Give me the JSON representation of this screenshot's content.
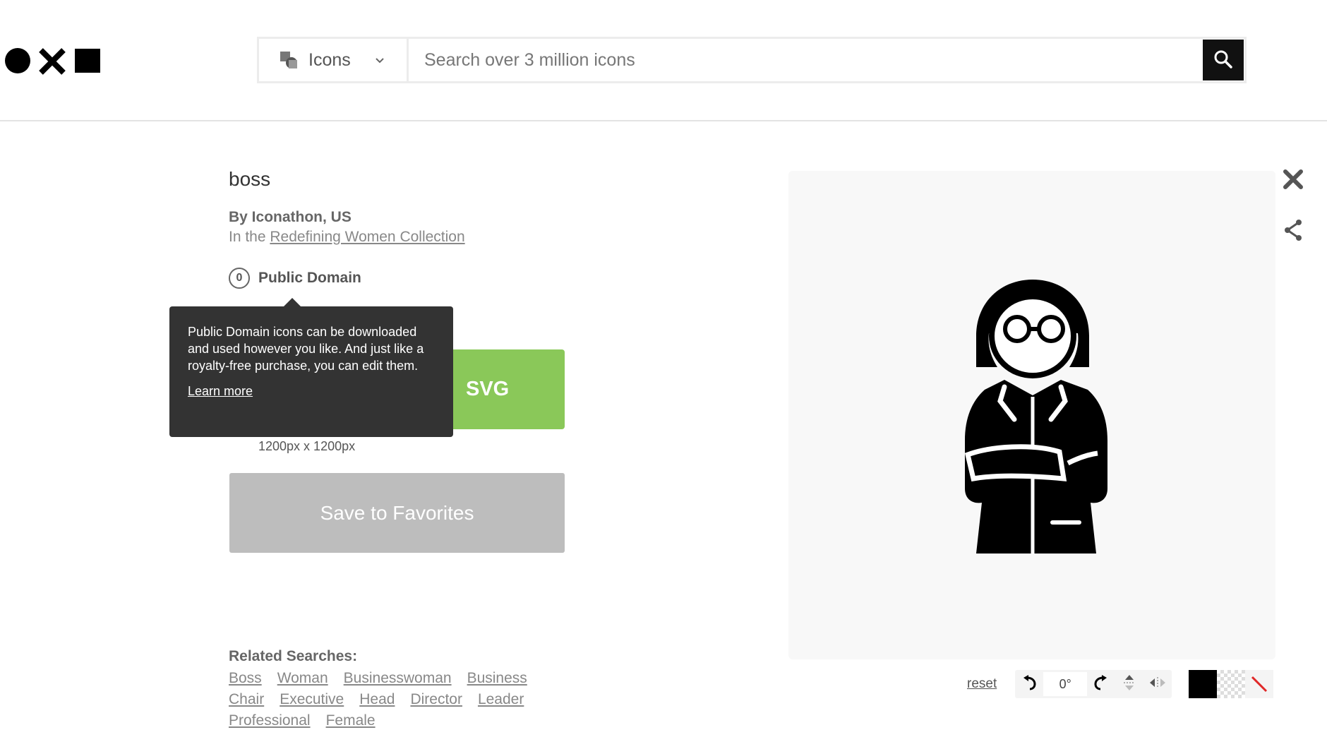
{
  "header": {
    "search_type": "Icons",
    "search_placeholder": "Search over 3 million icons"
  },
  "icon": {
    "title": "boss",
    "author": "By Iconathon, US",
    "collection_prefix": "In the ",
    "collection_link": "Redefining Women Collection",
    "license_symbol": "0",
    "license": "Public Domain"
  },
  "tooltip": {
    "text": "Public Domain icons can be downloaded and used however you like. And just like a royalty-free purchase, you can edit them.",
    "link": "Learn more"
  },
  "download": {
    "svg_label": "SVG",
    "size": "1200px x 1200px",
    "favorites_label": "Save to Favorites"
  },
  "related": {
    "heading": "Related Searches:",
    "tags": [
      "Boss",
      "Woman",
      "Businesswoman",
      "Business",
      "Chair",
      "Executive",
      "Head",
      "Director",
      "Leader",
      "Professional",
      "Female"
    ]
  },
  "toolbar": {
    "reset_label": "reset",
    "angle": "0°",
    "swatches": [
      "#000000",
      "transparent",
      "none"
    ]
  },
  "colors": {
    "accent_green": "#8ac859",
    "tooltip_bg": "#333333",
    "favorites_bg": "#bdbdbd"
  }
}
